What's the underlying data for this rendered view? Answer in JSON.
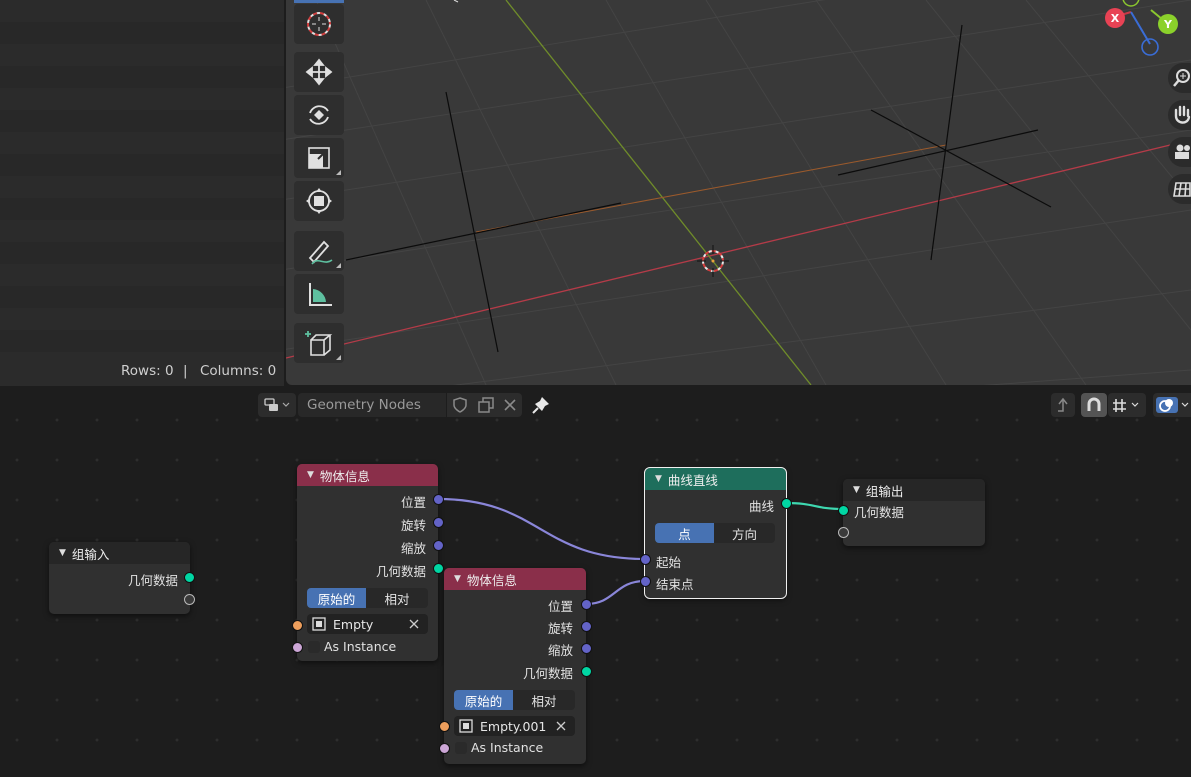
{
  "spreadsheet": {
    "rows_label": "Rows: 0",
    "separator": "|",
    "columns_label": "Columns: 0"
  },
  "viewport": {
    "gizmo": {
      "x_label": "X",
      "y_label": "Y"
    },
    "tools": [
      "cursor-icon",
      "move-icon",
      "rotate-icon",
      "scale-icon",
      "transform-icon",
      "annotate-icon",
      "measure-icon",
      "add-cube-icon"
    ],
    "nav": [
      "zoom-icon",
      "hand-icon",
      "camera-icon",
      "grid-icon"
    ]
  },
  "node_editor": {
    "tree_name": "Geometry Nodes",
    "nodes": {
      "group_input": {
        "title": "组输入",
        "output": "几何数据"
      },
      "object_info_1": {
        "title": "物体信息",
        "outputs": [
          "位置",
          "旋转",
          "缩放",
          "几何数据"
        ],
        "mode": {
          "original": "原始的",
          "relative": "相对",
          "selected": "原始的"
        },
        "object": "Empty",
        "as_instance": "As Instance"
      },
      "object_info_2": {
        "title": "物体信息",
        "outputs": [
          "位置",
          "旋转",
          "缩放",
          "几何数据"
        ],
        "mode": {
          "original": "原始的",
          "relative": "相对",
          "selected": "原始的"
        },
        "object": "Empty.001",
        "as_instance": "As Instance"
      },
      "curve_line": {
        "title": "曲线直线",
        "output": "曲线",
        "mode": {
          "points": "点",
          "direction": "方向",
          "selected": "点"
        },
        "inputs": [
          "起始",
          "结束点"
        ]
      },
      "group_output": {
        "title": "组输出",
        "input": "几何数据"
      }
    },
    "colors": {
      "object_header": "#8a2f4a",
      "curve_header": "#1e6e5c",
      "vector_socket": "#6363c7",
      "geometry_socket": "#00d6a3",
      "object_socket": "#ed9e5c",
      "boolean_socket": "#cca6d6",
      "active_segment": "#4772b3"
    }
  }
}
